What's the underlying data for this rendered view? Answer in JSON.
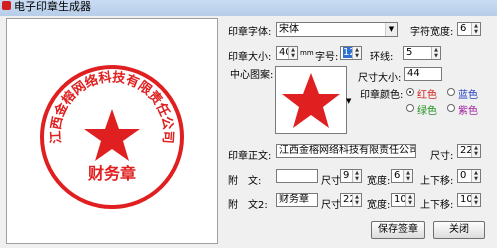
{
  "window": {
    "title": "电子印章生成器"
  },
  "form": {
    "font_label": "印章字体:",
    "font_value": "宋体",
    "char_width_label": "字符宽度:",
    "char_width_value": "6",
    "size_label": "印章大小:",
    "size_value": "40",
    "size_unit": "mm",
    "font_size_label": "字号:",
    "font_size_value": "12",
    "ring_label": "环线:",
    "ring_value": "5",
    "center_label": "中心图案:",
    "center_size_label": "尺寸大小:",
    "center_size_value": "44",
    "color_label": "印章颜色:",
    "colors": [
      {
        "label": "红色",
        "hex": "#d02020",
        "selected": true
      },
      {
        "label": "蓝色",
        "hex": "#2040c0",
        "selected": false
      },
      {
        "label": "绿色",
        "hex": "#209020",
        "selected": false
      },
      {
        "label": "紫色",
        "hex": "#a020a0",
        "selected": false
      }
    ],
    "main_text_label": "印章正文:",
    "main_text_value": "江西金榕网络科技有限责任公司",
    "main_text_size_label": "尺寸:",
    "main_text_size_value": "22",
    "att1_label": "附　文:",
    "att1_value": "",
    "att1_size_label": "尺寸",
    "att1_size_value": "9",
    "att1_width_label": "宽度:",
    "att1_width_value": "6",
    "att1_offset_label": "上下移:",
    "att1_offset_value": "0",
    "att2_label": "附　文2:",
    "att2_value": "财务章",
    "att2_size_label": "尺寸",
    "att2_size_value": "22",
    "att2_width_label": "宽度:",
    "att2_width_value": "10",
    "att2_offset_label": "上下移:",
    "att2_offset_value": "10"
  },
  "buttons": {
    "save": "保存签章",
    "close": "关闭"
  },
  "seal": {
    "arc_text": "江西金榕网络科技有限责任公司",
    "bottom_text": "财务章",
    "color": "#e02020"
  }
}
